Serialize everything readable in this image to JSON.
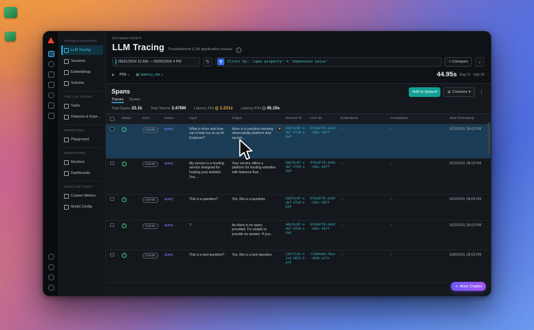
{
  "header": {
    "breadcrumb": "test-space-covid-4",
    "title": "LLM Tracing",
    "subtitle": "Troubleshoot LLM application issues"
  },
  "rail_icons_top": [
    {
      "name": "overview-icon",
      "cls": "active"
    },
    {
      "name": "chat-icon",
      "cls": "round"
    },
    {
      "name": "layers-icon",
      "cls": ""
    },
    {
      "name": "database-icon",
      "cls": ""
    },
    {
      "name": "bell-icon",
      "cls": "round"
    },
    {
      "name": "experiments-icon",
      "cls": ""
    },
    {
      "name": "monitors-icon",
      "cls": ""
    }
  ],
  "rail_icons_bottom": [
    {
      "name": "gear-icon",
      "cls": "round"
    },
    {
      "name": "announcements-icon",
      "cls": "round"
    },
    {
      "name": "info-icon",
      "cls": "round"
    },
    {
      "name": "profile-icon",
      "cls": "round"
    }
  ],
  "sidebar": [
    {
      "cls": "section",
      "label": "TROUBLESHOOTING"
    },
    {
      "cls": "item active",
      "label": "LLM Tracing",
      "icon": "llm-tracing-icon"
    },
    {
      "cls": "item",
      "label": "Sessions",
      "icon": "sessions-icon"
    },
    {
      "cls": "item",
      "label": "Embeddings",
      "icon": "embeddings-icon"
    },
    {
      "cls": "item",
      "label": "Schema",
      "icon": "schema-icon"
    },
    {
      "cls": "section",
      "label": "THE LLM TOOLKIT"
    },
    {
      "cls": "item",
      "label": "Tasks",
      "icon": "tasks-icon"
    },
    {
      "cls": "item",
      "label": "Datasets & Expe...",
      "icon": "datasets-icon"
    },
    {
      "cls": "section",
      "label": "PROMPTING"
    },
    {
      "cls": "item",
      "label": "Playground",
      "icon": "playground-icon"
    },
    {
      "cls": "section",
      "label": "MONITORING"
    },
    {
      "cls": "item",
      "label": "Monitors",
      "icon": "monitors-nav-icon"
    },
    {
      "cls": "item",
      "label": "Dashboards",
      "icon": "dashboards-icon"
    },
    {
      "cls": "section",
      "label": "SPACE SETTINGS"
    },
    {
      "cls": "item",
      "label": "Custom Metrics",
      "icon": "custom-metrics-icon"
    },
    {
      "cls": "item",
      "label": "Model Config",
      "icon": "model-config-icon"
    }
  ],
  "filterbar": {
    "date_range": "08/31/2024 12 AM   —   09/30/2024 4 PM",
    "filter_query": "filter by: 'span property' = 'dimension value'",
    "compare": "+ Compare"
  },
  "metricbar": {
    "percentile": "P99",
    "metric": "latency_ms",
    "value": "44.95s",
    "range": "Aug 31 - Sep 30"
  },
  "spans": {
    "title": "Spans",
    "tabs": [
      {
        "label": "Traces",
        "cls": "active"
      },
      {
        "label": "Spans",
        "cls": ""
      }
    ],
    "stats": [
      {
        "label": "Total Spans",
        "value": "23.1k",
        "cls": ""
      },
      {
        "label": "Total Tokens",
        "value": "2.476M",
        "cls": ""
      },
      {
        "label": "Latency P50",
        "value": "2.231s",
        "cls": "amber clock"
      },
      {
        "label": "Latency P99",
        "value": "45.19s",
        "cls": "clock"
      }
    ],
    "add_to_dataset": "Add to dataset",
    "columns": "Columns"
  },
  "table": {
    "headers": [
      "Status",
      "Kind",
      "Name",
      "Input",
      "Output",
      "Session ID",
      "User ID",
      "Evaluations",
      "Annotations",
      "Start Timestamp"
    ],
    "rows": [
      {
        "cls": "selected",
        "kind": "CHAIN",
        "name": "query",
        "input": "What is Arize and how can it help me as an AI Engineer?",
        "output": "Arize is a machine learning observability platform that assists...",
        "session_id": "8dbfbc8f-adb7-47a9-a6a9",
        "user_id": "8f6a8778-da9d-44bc-b6ff",
        "evaluations": "--",
        "annotations": "--",
        "timestamp": "9/29/2024, 08:03 PM",
        "filter_icon": true
      },
      {
        "cls": "",
        "kind": "CHAIN",
        "name": "query",
        "input": "My service is a hosting service designed for hosting your website. You...",
        "output": "Your service offers a platform for hosting websites with features that...",
        "session_id": "8dbfbc8f-adb7-47a9-a6a9",
        "user_id": "8f6a8778-da9d-44bc-b6ff",
        "evaluations": "--",
        "annotations": "--",
        "timestamp": "9/29/2024, 08:03 PM"
      },
      {
        "cls": "",
        "kind": "CHAIN",
        "name": "query",
        "input": "This is a question?",
        "output": "Yes, this is a question.",
        "session_id": "8dbfbc8f-adb7-47a9-a6a9",
        "user_id": "8f6a8778-da9d-44bc-b6ff",
        "evaluations": "--",
        "annotations": "--",
        "timestamp": "9/29/2024, 08:03 PM"
      },
      {
        "cls": "",
        "kind": "CHAIN",
        "name": "query",
        "input": "?",
        "output": "As there is no query provided, I'm unable to provide an answer. If you...",
        "session_id": "8dbfbc8f-adb7-47a9-a6a9",
        "user_id": "8f6a8778-da9d-44bc-b6ff",
        "evaluations": "--",
        "annotations": "--",
        "timestamp": "9/29/2024, 08:03 PM"
      },
      {
        "cls": "",
        "kind": "CHAIN",
        "name": "query",
        "input": "This is a test question?",
        "output": "Yes, this is a test question.",
        "session_id": "23677c5e-21a4-4652-9acb",
        "user_id": "71d98a9d-f6aa-403b-a17e",
        "evaluations": "--",
        "annotations": "--",
        "timestamp": "9/28/2024, 08:03 PM"
      }
    ]
  },
  "copilot": {
    "label": "Arize Copilot"
  }
}
